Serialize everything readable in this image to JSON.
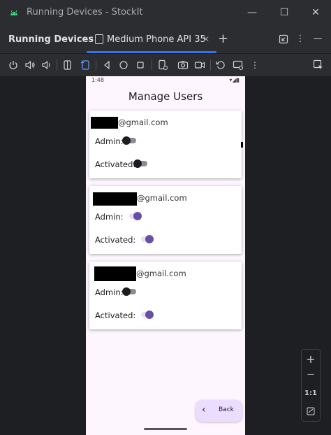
{
  "window": {
    "title": "Running Devices - StockIt",
    "minimize": "—",
    "maximize": "☐",
    "close": "✕"
  },
  "tabbar": {
    "panel_title": "Running Devices",
    "tab_label": "Medium Phone API 35",
    "tab_close": "✕",
    "add_tab": "+",
    "more": "⋮",
    "hide": "—"
  },
  "toolbar": {
    "icons": [
      "power-icon",
      "volume-up-icon",
      "volume-down-icon",
      "rotate-left-icon",
      "rotate-right-icon",
      "back-icon",
      "home-icon",
      "overview-icon",
      "device-settings-icon",
      "screenshot-icon",
      "screen-record-icon",
      "reset-icon",
      "snapshot-icon",
      "more-icon",
      "inspect-icon"
    ]
  },
  "phone": {
    "status_time": "1:48",
    "screen_title": "Manage Users",
    "users": [
      {
        "email": "@gmail.com",
        "admin_label": "Admin:",
        "activated_label": "Activated:",
        "admin": false,
        "activated": false
      },
      {
        "email": "@gmail.com",
        "admin_label": "Admin:",
        "activated_label": "Activated:",
        "admin": true,
        "activated": true
      },
      {
        "email": "@gmail.com",
        "admin_label": "Admin:",
        "activated_label": "Activated:",
        "admin": false,
        "activated": true
      }
    ],
    "back_button": "Back"
  },
  "zoom": {
    "zoom_in": "+",
    "zoom_out": "—",
    "actual_size": "1:1"
  },
  "colors": {
    "accent": "#3574f0",
    "switch_on": "#6750a4",
    "switch_on_track": "#e8def8",
    "switch_off_thumb": "#1d1b20",
    "back_button_bg": "#eaddff"
  }
}
